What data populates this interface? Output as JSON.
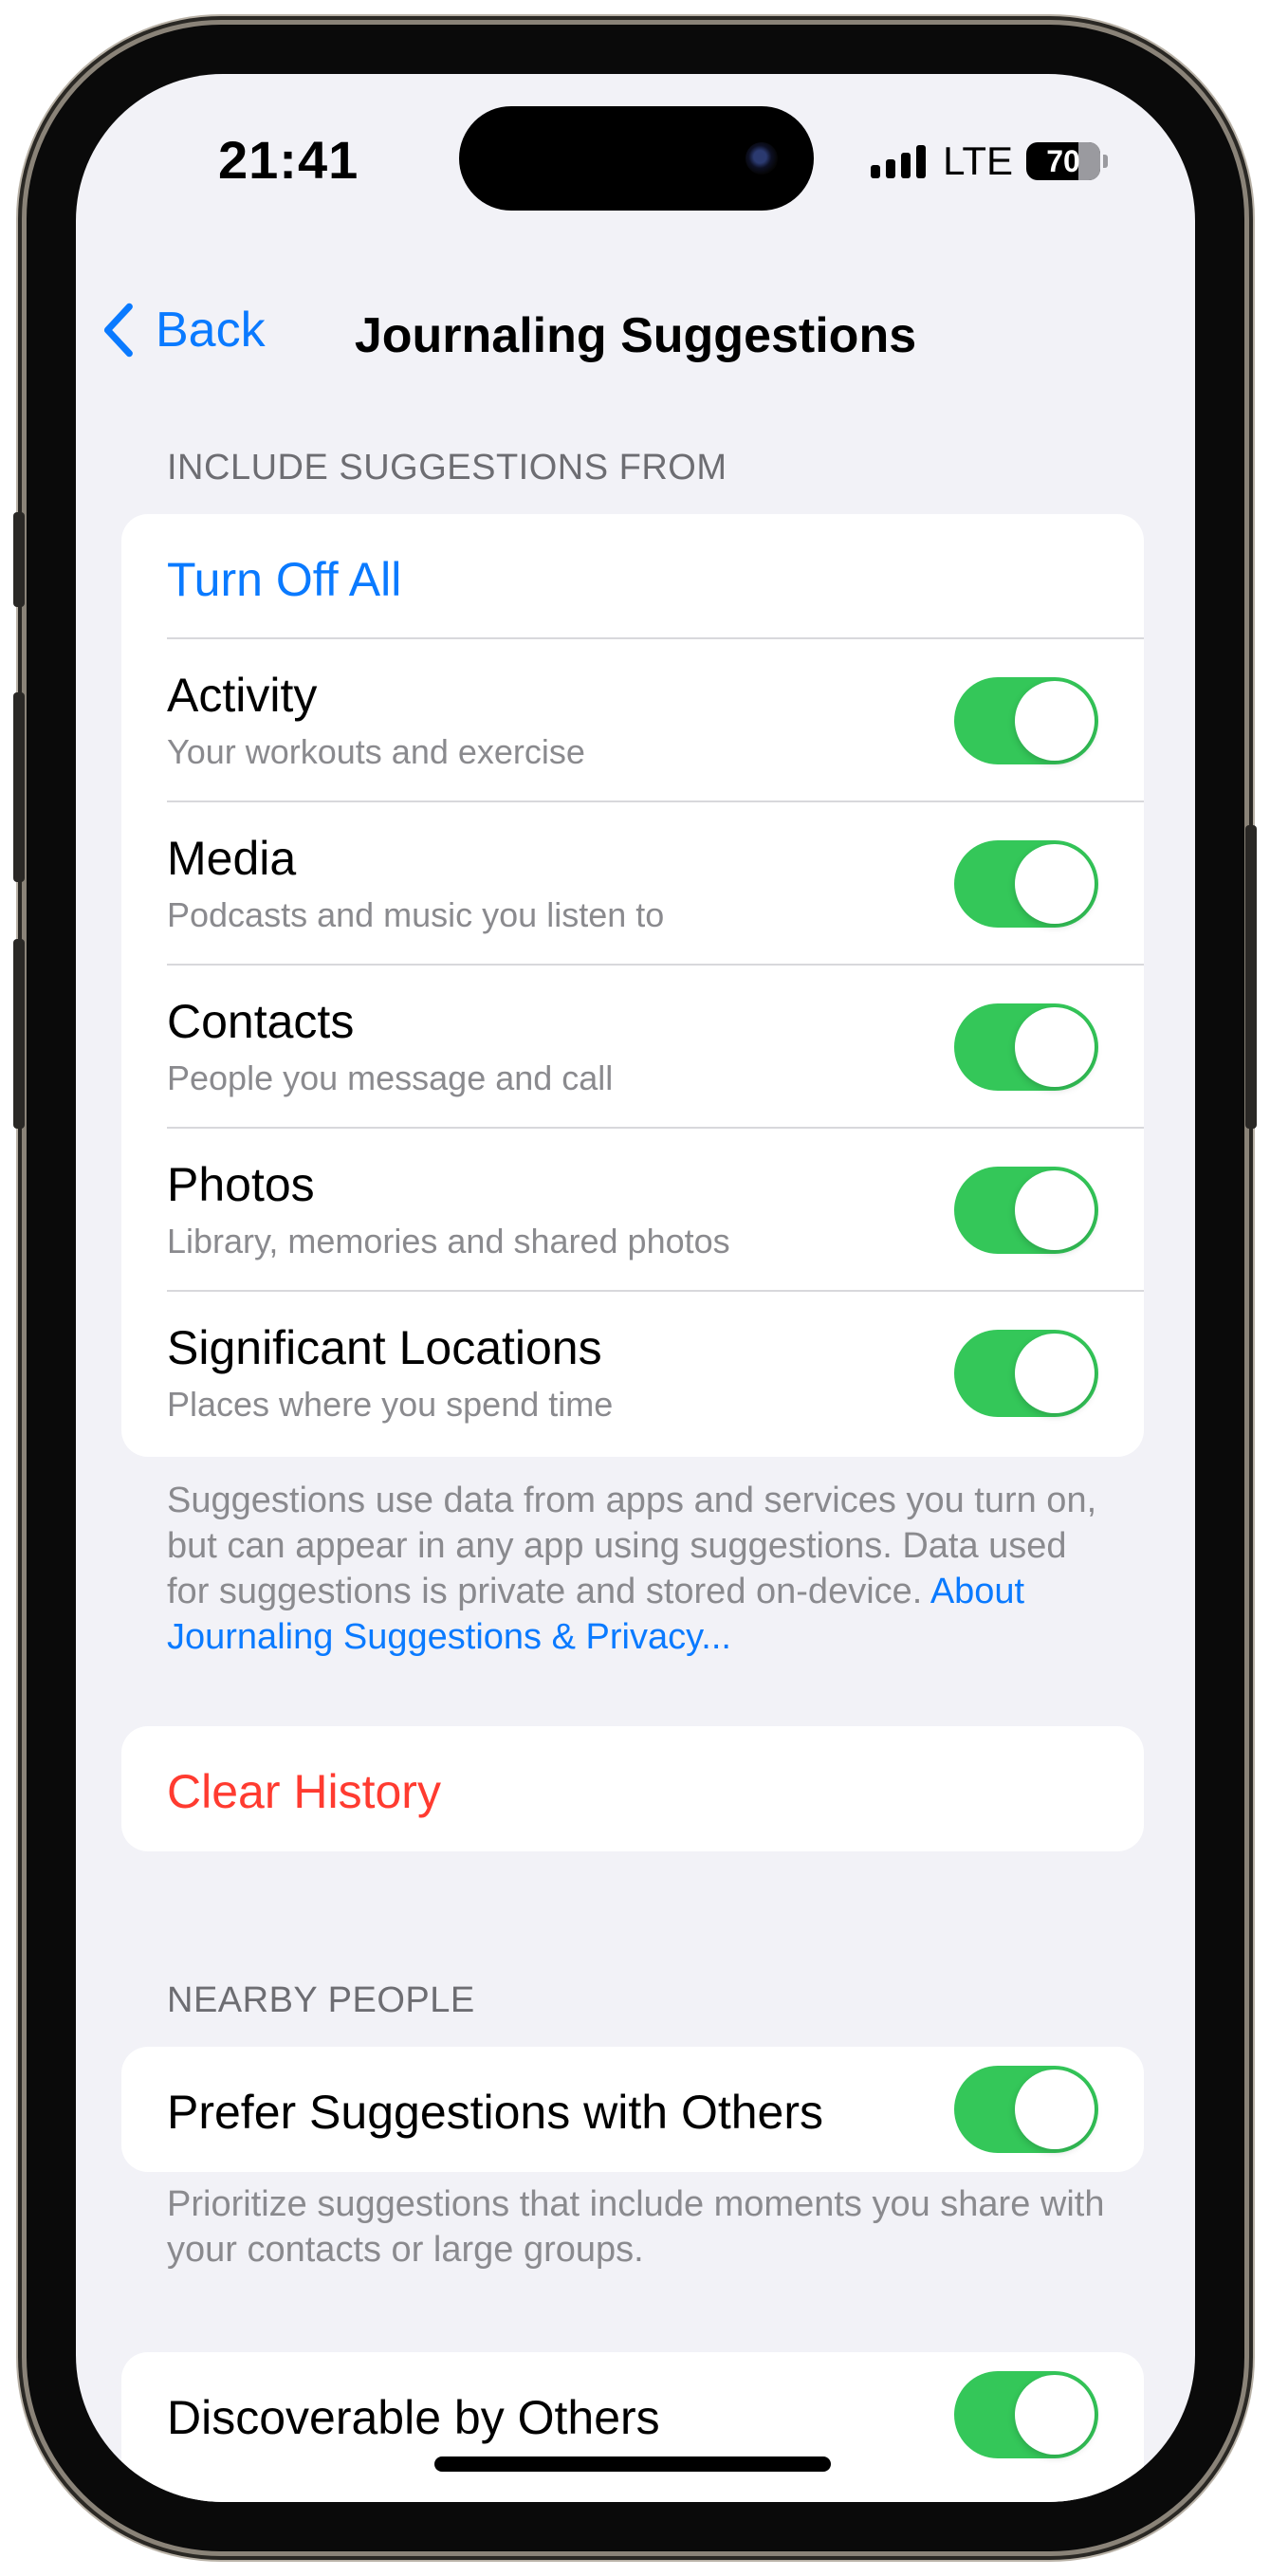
{
  "status_bar": {
    "time": "21:41",
    "network": "LTE",
    "battery_level": "70"
  },
  "nav": {
    "back_label": "Back",
    "title": "Journaling Suggestions"
  },
  "section_include": {
    "header": "INCLUDE SUGGESTIONS FROM",
    "turn_off_all_label": "Turn Off All",
    "items": [
      {
        "title": "Activity",
        "subtitle": "Your workouts and exercise",
        "enabled": true
      },
      {
        "title": "Media",
        "subtitle": "Podcasts and music you listen to",
        "enabled": true
      },
      {
        "title": "Contacts",
        "subtitle": "People you message and call",
        "enabled": true
      },
      {
        "title": "Photos",
        "subtitle": "Library, memories and shared photos",
        "enabled": true
      },
      {
        "title": "Significant Locations",
        "subtitle": "Places where you spend time",
        "enabled": true
      }
    ],
    "footer_text": "Suggestions use data from apps and services you turn on, but can appear in any app using suggestions. Data used for suggestions is private and stored on-device.",
    "footer_link": "About Journaling Suggestions & Privacy..."
  },
  "clear_history_label": "Clear History",
  "section_nearby": {
    "header": "NEARBY PEOPLE",
    "prefer_label": "Prefer Suggestions with Others",
    "prefer_enabled": true,
    "prefer_footer": "Prioritize suggestions that include moments you share with your contacts or large groups.",
    "discoverable_label": "Discoverable by Others",
    "discoverable_enabled": true
  },
  "colors": {
    "accent": "#0a7aff",
    "destructive": "#ff3b30",
    "toggle_on": "#34c759",
    "background": "#f2f2f7"
  }
}
